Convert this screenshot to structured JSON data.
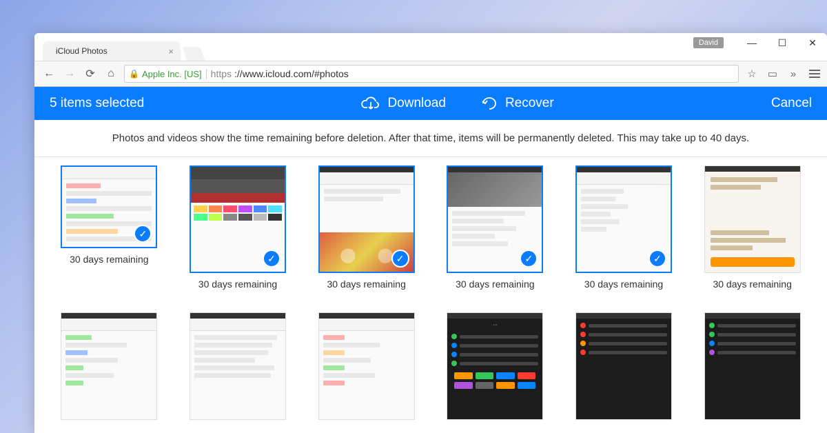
{
  "window": {
    "user_tag": "David"
  },
  "tab": {
    "title": "iCloud Photos"
  },
  "url": {
    "ev_label": "Apple Inc. [US]",
    "protocol": "https",
    "rest": "://www.icloud.com/#photos"
  },
  "app_bar": {
    "selection": "5 items selected",
    "download": "Download",
    "recover": "Recover",
    "cancel": "Cancel"
  },
  "info_banner": "Photos and videos show the time remaining before deletion. After that time, items will be permanently deleted. This may take up to 40 days.",
  "items": [
    {
      "caption": "30 days remaining",
      "selected": true
    },
    {
      "caption": "30 days remaining",
      "selected": true
    },
    {
      "caption": "30 days remaining",
      "selected": true
    },
    {
      "caption": "30 days remaining",
      "selected": true
    },
    {
      "caption": "30 days remaining",
      "selected": true
    },
    {
      "caption": "30 days remaining",
      "selected": false
    },
    {
      "caption": "",
      "selected": false
    },
    {
      "caption": "",
      "selected": false
    },
    {
      "caption": "",
      "selected": false
    },
    {
      "caption": "",
      "selected": false
    },
    {
      "caption": "",
      "selected": false
    },
    {
      "caption": "",
      "selected": false
    }
  ]
}
